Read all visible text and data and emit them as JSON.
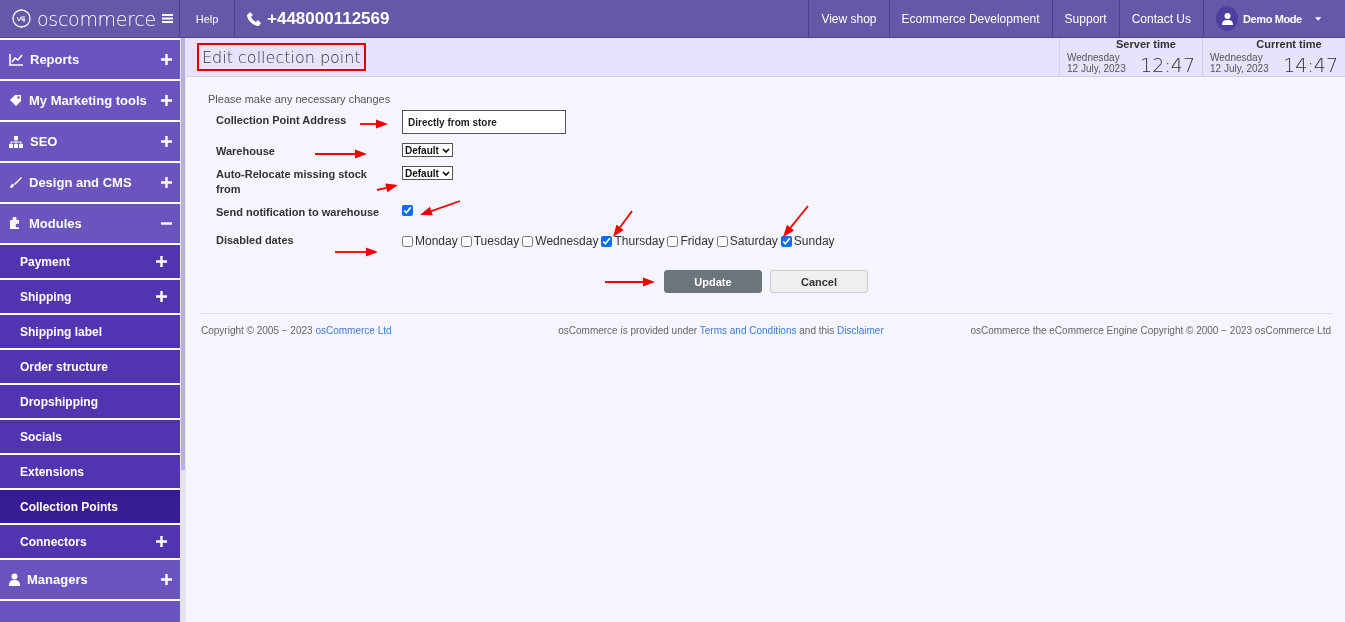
{
  "topbar": {
    "logo": "oscommerce",
    "help": "Help",
    "phone": "+448000112569",
    "nav": [
      "View shop",
      "Ecommerce Development",
      "Support",
      "Contact Us"
    ],
    "user": "Demo Mode"
  },
  "sidebar": {
    "items": [
      {
        "label": "Reports",
        "expanded": false,
        "selected": false
      },
      {
        "label": "My Marketing tools",
        "expanded": false,
        "selected": false
      },
      {
        "label": "SEO",
        "expanded": false,
        "selected": false
      },
      {
        "label": "Design and CMS",
        "expanded": false,
        "selected": false
      },
      {
        "label": "Modules",
        "expanded": true,
        "selected": false,
        "children": [
          {
            "label": "Payment",
            "expanded": false,
            "selected": false
          },
          {
            "label": "Shipping",
            "expanded": false,
            "selected": false
          },
          {
            "label": "Shipping label",
            "selected": false
          },
          {
            "label": "Order structure",
            "selected": false
          },
          {
            "label": "Dropshipping",
            "selected": false
          },
          {
            "label": "Socials",
            "selected": false
          },
          {
            "label": "Extensions",
            "selected": false
          },
          {
            "label": "Collection Points",
            "selected": true
          },
          {
            "label": "Connectors",
            "expanded": false,
            "selected": false
          }
        ]
      },
      {
        "label": "Managers",
        "expanded": false,
        "selected": false
      }
    ]
  },
  "header": {
    "title": "Edit collection point",
    "clocks": [
      {
        "label": "Server time",
        "day": "Wednesday",
        "date": "12 July, 2023",
        "time": "12:47"
      },
      {
        "label": "Current time",
        "day": "Wednesday",
        "date": "12 July, 2023",
        "time": "14:47"
      }
    ]
  },
  "form": {
    "intro": "Please make any necessary changes",
    "fields": [
      {
        "kind": "text",
        "label": "Collection Point Address",
        "value": "Directly from store"
      },
      {
        "kind": "select",
        "label": "Warehouse",
        "value": "Default"
      },
      {
        "kind": "select",
        "label": "Auto-Relocate missing stock from",
        "value": "Default"
      },
      {
        "kind": "checkbox",
        "label": "Send notification to warehouse",
        "checked": true
      },
      {
        "kind": "checkboxes",
        "label": "Disabled dates",
        "options": [
          {
            "label": "Monday",
            "checked": false
          },
          {
            "label": "Tuesday",
            "checked": false
          },
          {
            "label": "Wednesday",
            "checked": false
          },
          {
            "label": "Thursday",
            "checked": true
          },
          {
            "label": "Friday",
            "checked": false
          },
          {
            "label": "Saturday",
            "checked": false
          },
          {
            "label": "Sunday",
            "checked": true
          }
        ]
      }
    ],
    "buttons": [
      {
        "kind": "primary",
        "label": "Update"
      },
      {
        "kind": "secondary",
        "label": "Cancel"
      }
    ]
  },
  "footer": [
    [
      {
        "kind": "text",
        "text": "Copyright © 2005 − 2023 "
      },
      {
        "kind": "link",
        "text": "osCommerce Ltd"
      }
    ],
    [
      {
        "kind": "text",
        "text": "osCommerce is provided under "
      },
      {
        "kind": "link",
        "text": "Terms and Conditions"
      },
      {
        "kind": "text",
        "text": " and this "
      },
      {
        "kind": "link",
        "text": "Disclaimer"
      }
    ],
    [
      {
        "kind": "text",
        "text": "osCommerce the eCommerce Engine Copyright © 2000 − 2023 osCommerce Ltd"
      }
    ]
  ]
}
